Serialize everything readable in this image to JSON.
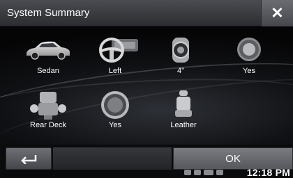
{
  "title": "System Summary",
  "close_icon": "close-icon",
  "items": [
    {
      "id": "car-type",
      "label": "Sedan",
      "icon": "sedan-car-icon"
    },
    {
      "id": "steering",
      "label": "Left",
      "icon": "steering-wheel-icon"
    },
    {
      "id": "speaker-size",
      "label": "4\"",
      "icon": "speaker-icon"
    },
    {
      "id": "tweeter",
      "label": "Yes",
      "icon": "tweeter-icon"
    },
    {
      "id": "rear-speaker",
      "label": "Rear Deck",
      "icon": "rear-deck-seats-icon"
    },
    {
      "id": "subwoofer",
      "label": "Yes",
      "icon": "subwoofer-icon"
    },
    {
      "id": "seat",
      "label": "Leather",
      "icon": "leather-seat-icon"
    }
  ],
  "footer": {
    "back_icon": "back-arrow-icon",
    "ok_label": "OK"
  },
  "status": {
    "time": "12:18 PM"
  }
}
